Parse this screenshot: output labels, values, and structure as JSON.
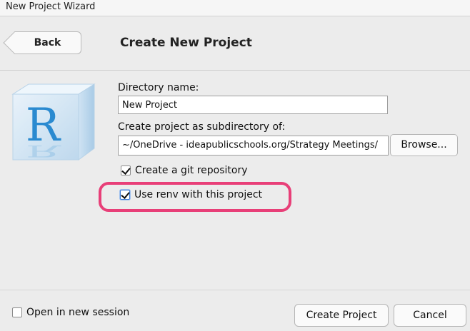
{
  "window": {
    "title": "New Project Wizard"
  },
  "header": {
    "back_label": "Back",
    "page_title": "Create New Project"
  },
  "form": {
    "directory_label": "Directory name:",
    "directory_value": "New Project",
    "subdir_label": "Create project as subdirectory of:",
    "subdir_value": "~/OneDrive - ideapublicschools.org/Strategy Meetings/",
    "browse_label": "Browse...",
    "git_label": "Create a git repository",
    "git_checked": true,
    "renv_label": "Use renv with this project",
    "renv_checked": true
  },
  "highlight": {
    "color": "#e83f78"
  },
  "logo": {
    "icon": "r-logo-icon",
    "letter": "R"
  },
  "footer": {
    "new_session_label": "Open in new session",
    "new_session_checked": false,
    "create_label": "Create Project",
    "cancel_label": "Cancel"
  }
}
